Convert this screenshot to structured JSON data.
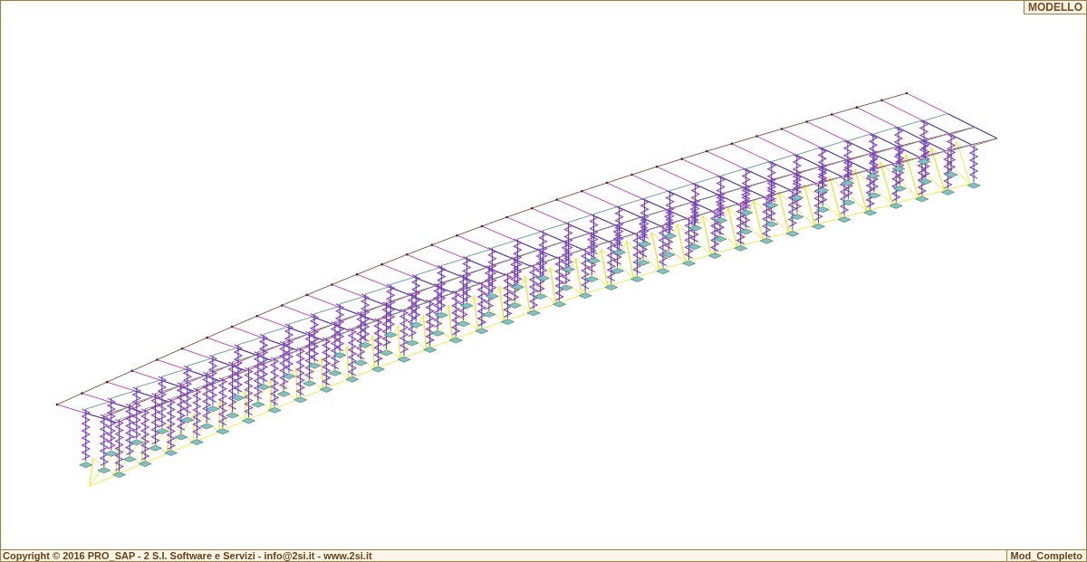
{
  "view_label": "MODELLO",
  "status_bar": {
    "copyright": "Copyright © 2016 PRO_SAP - 2 S.I. Software e Servizi - info@2si.it - www.2si.it",
    "mode": "Mod_Completo"
  }
}
